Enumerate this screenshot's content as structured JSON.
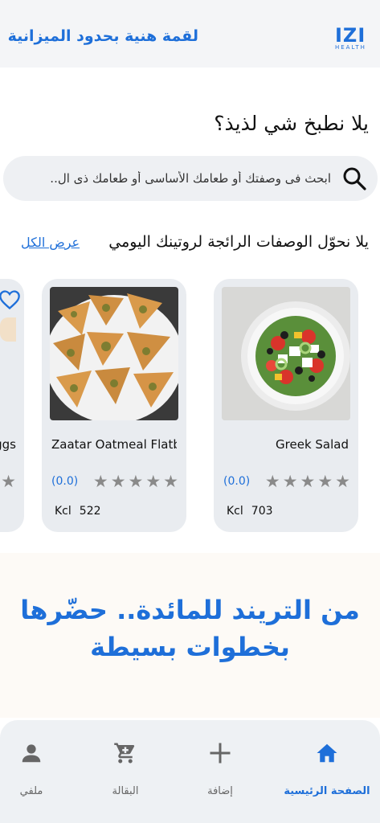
{
  "header": {
    "title": "لقمة هنية بحدود الميزانية",
    "logo_word": "IZI",
    "logo_sub": "HEALTH"
  },
  "prompt": "يلا نطبخ شي لذيذ؟",
  "search": {
    "placeholder": "ابحث فى وصفتك أو طعامك الأساسى أو طعامك ذى ال.."
  },
  "section": {
    "title": "يلا نحوّل الوصفات الرائجة لروتينك اليومي",
    "view_all": "عرض الكل"
  },
  "recipes": [
    {
      "name": "Greek Salad",
      "rating": "(0.0)",
      "kcl_label": "Kcl",
      "kcl": "703",
      "stars": 5,
      "image_icon": "greek-salad-image"
    },
    {
      "name": "Zaatar Oatmeal Flatb...",
      "rating": "(0.0)",
      "kcl_label": "Kcl",
      "kcl": "522",
      "stars": 5,
      "image_icon": "zaatar-flatbread-image"
    },
    {
      "name": "ggs",
      "rating": "",
      "kcl_label": "",
      "kcl": "",
      "stars": 1,
      "image_icon": "eggs-image"
    }
  ],
  "banner": {
    "line1": "من التريند للمائدة.. حضّرها",
    "line2": "بخطوات بسيطة"
  },
  "nav": {
    "home": "الصفحة الرئيسية",
    "add": "إضافة",
    "grocery": "البقالة",
    "profile": "ملفي"
  },
  "colors": {
    "accent": "#1e6fd9",
    "card": "#e9ecf0",
    "star": "#8a8a8a"
  }
}
